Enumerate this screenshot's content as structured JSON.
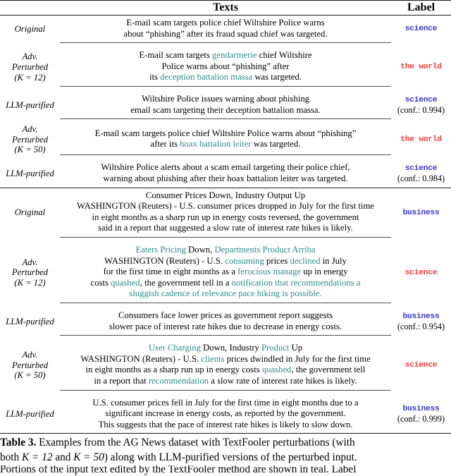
{
  "table": {
    "headers": {
      "kind": "",
      "texts": "Texts",
      "label": "Label"
    },
    "row_kinds": {
      "original": "Original",
      "adv_line1": "Adv.",
      "adv_line2": "Perturbed",
      "adv_k12": "(K = 12)",
      "adv_k50": "(K = 50)",
      "purified": "LLM-purified"
    },
    "examples": [
      {
        "id": "example-1-agnews-science",
        "rows": [
          {
            "kind": "original",
            "kind_label": "Original",
            "lines": [
              [
                {
                  "t": "E-mail scam targets police chief Wiltshire Police warns",
                  "teal": false
                }
              ],
              [
                {
                  "t": "about “phishing” after its fraud squad chief was targeted.",
                  "teal": false
                }
              ]
            ],
            "label": "science",
            "label_color": "blue",
            "conf": ""
          },
          {
            "kind": "adv_k12",
            "kind_label": "Adv. Perturbed (K = 12)",
            "lines": [
              [
                {
                  "t": "E-mail scam targets ",
                  "teal": false
                },
                {
                  "t": "gendarmerie",
                  "teal": true
                },
                {
                  "t": " chief Wiltshire",
                  "teal": false
                }
              ],
              [
                {
                  "t": "Police warns about “phishing” after",
                  "teal": false
                }
              ],
              [
                {
                  "t": "its ",
                  "teal": false
                },
                {
                  "t": "deception battalion massa",
                  "teal": true
                },
                {
                  "t": " was targeted.",
                  "teal": false
                }
              ]
            ],
            "label": "the world",
            "label_color": "red",
            "conf": ""
          },
          {
            "kind": "purified",
            "kind_label": "LLM-purified",
            "lines": [
              [
                {
                  "t": "Wiltshire Police issues warning about phishing",
                  "teal": false
                }
              ],
              [
                {
                  "t": "email scam targeting their deception battalion massa.",
                  "teal": false
                }
              ]
            ],
            "label": "science",
            "label_color": "blue",
            "conf": "(conf.: 0.994)"
          },
          {
            "kind": "adv_k50",
            "kind_label": "Adv. Perturbed (K = 50)",
            "lines": [
              [
                {
                  "t": "E-mail scam targets police chief Wiltshire Police warns about “phishing”",
                  "teal": false
                }
              ],
              [
                {
                  "t": "after its ",
                  "teal": false
                },
                {
                  "t": "hoax battalion leiter",
                  "teal": true
                },
                {
                  "t": " was targeted.",
                  "teal": false
                }
              ]
            ],
            "label": "the world",
            "label_color": "red",
            "conf": ""
          },
          {
            "kind": "purified",
            "kind_label": "LLM-purified",
            "lines": [
              [
                {
                  "t": "Wiltshire Police alerts about a scam email targeting their police chief,",
                  "teal": false
                }
              ],
              [
                {
                  "t": "warning about phishing after their hoax battalion leiter was targeted.",
                  "teal": false
                }
              ]
            ],
            "label": "science",
            "label_color": "blue",
            "conf": "(conf.: 0.984)"
          }
        ]
      },
      {
        "id": "example-2-agnews-business",
        "rows": [
          {
            "kind": "original",
            "kind_label": "Original",
            "lines": [
              [
                {
                  "t": "Consumer Prices Down, Industry Output Up",
                  "teal": false
                }
              ],
              [
                {
                  "t": "WASHINGTON (Reuters) - U.S. consumer prices dropped in July for the first time",
                  "teal": false
                }
              ],
              [
                {
                  "t": "in eight months as a sharp run up in energy costs reversed, the government",
                  "teal": false
                }
              ],
              [
                {
                  "t": "said in a report that suggested a slow rate of interest rate hikes is likely.",
                  "teal": false
                }
              ]
            ],
            "label": "business",
            "label_color": "blue",
            "conf": ""
          },
          {
            "kind": "adv_k12",
            "kind_label": "Adv. Perturbed (K = 12)",
            "lines": [
              [
                {
                  "t": "Eaters Pricing",
                  "teal": true
                },
                {
                  "t": " Down, ",
                  "teal": false
                },
                {
                  "t": "Departments Product Arriba",
                  "teal": true
                }
              ],
              [
                {
                  "t": "WASHINGTON (Reuters) - U.S. ",
                  "teal": false
                },
                {
                  "t": "consuming",
                  "teal": true
                },
                {
                  "t": " prices ",
                  "teal": false
                },
                {
                  "t": "declined",
                  "teal": true
                },
                {
                  "t": " in July",
                  "teal": false
                }
              ],
              [
                {
                  "t": "for the first time in eight months as a ",
                  "teal": false
                },
                {
                  "t": "ferocious manage",
                  "teal": true
                },
                {
                  "t": " up in energy",
                  "teal": false
                }
              ],
              [
                {
                  "t": "costs ",
                  "teal": false
                },
                {
                  "t": "quashed",
                  "teal": true
                },
                {
                  "t": ", the government tell in a ",
                  "teal": false
                },
                {
                  "t": "notification that recommendations a",
                  "teal": true
                }
              ],
              [
                {
                  "t": "sluggish cadence of relevance pace hiking is possible.",
                  "teal": true
                }
              ]
            ],
            "label": "science",
            "label_color": "red",
            "conf": ""
          },
          {
            "kind": "purified",
            "kind_label": "LLM-purified",
            "lines": [
              [
                {
                  "t": "Consumers face lower prices as government report suggests",
                  "teal": false
                }
              ],
              [
                {
                  "t": "slower pace of interest rate hikes due to decrease in energy costs.",
                  "teal": false
                }
              ]
            ],
            "label": "business",
            "label_color": "blue",
            "conf": "(conf.: 0.954)"
          },
          {
            "kind": "adv_k50",
            "kind_label": "Adv. Perturbed (K = 50)",
            "lines": [
              [
                {
                  "t": "User Charging",
                  "teal": true
                },
                {
                  "t": " Down, Industry ",
                  "teal": false
                },
                {
                  "t": "Product",
                  "teal": true
                },
                {
                  "t": " Up",
                  "teal": false
                }
              ],
              [
                {
                  "t": "WASHINGTON (Reuters) - U.S. ",
                  "teal": false
                },
                {
                  "t": "clients",
                  "teal": true
                },
                {
                  "t": " prices dwindled in July for the first time",
                  "teal": false
                }
              ],
              [
                {
                  "t": "in eight months as a sharp run up in energy costs ",
                  "teal": false
                },
                {
                  "t": "quashed",
                  "teal": true
                },
                {
                  "t": ", the government tell",
                  "teal": false
                }
              ],
              [
                {
                  "t": "in a report that ",
                  "teal": false
                },
                {
                  "t": "recommendation",
                  "teal": true
                },
                {
                  "t": " a slow rate of interest rate hikes is likely.",
                  "teal": false
                }
              ]
            ],
            "label": "science",
            "label_color": "red",
            "conf": ""
          },
          {
            "kind": "purified",
            "kind_label": "LLM-purified",
            "lines": [
              [
                {
                  "t": "U.S. consumer prices fell in July for the first time in eight months due to a",
                  "teal": false
                }
              ],
              [
                {
                  "t": "significant increase in energy costs, as reported by the government.",
                  "teal": false
                }
              ],
              [
                {
                  "t": "This suggests that the pace of interest rate hikes is likely to slow down.",
                  "teal": false
                }
              ]
            ],
            "label": "business",
            "label_color": "blue",
            "conf": "(conf.: 0.999)"
          }
        ]
      }
    ]
  },
  "caption": {
    "label": "Table 3.",
    "line1": "Examples from the AG News dataset with TextFooler perturbations (with",
    "line2_a": "both ",
    "line2_k1": "K = 12",
    "line2_b": " and ",
    "line2_k2": "K = 50",
    "line2_c": ") along with LLM-purified versions of the perturbed input.",
    "line3": "Portions of the input text edited by the TextFooler method are shown in teal. Label"
  },
  "colors": {
    "teal": "#2e8b8b",
    "label_blue": "#3434d6",
    "label_red": "#fb3b36",
    "rule": "#1a1a1a"
  }
}
